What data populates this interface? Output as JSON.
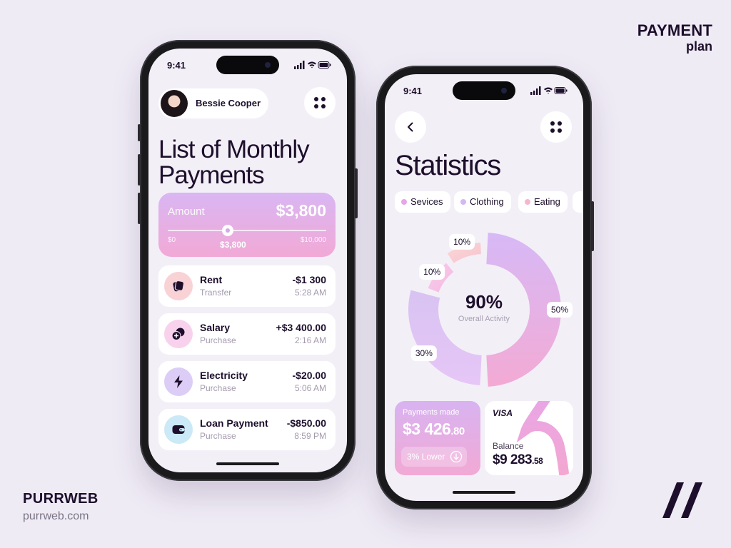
{
  "brand": {
    "top_right_line1": "PAYMENT",
    "top_right_line2": "plan",
    "bottom_left_name": "PURRWEB",
    "bottom_left_url": "purrweb.com"
  },
  "phone1": {
    "status_time": "9:41",
    "user_name": "Bessie Cooper",
    "title_line1": "List of Monthly",
    "title_line2": "Payments",
    "amount": {
      "label": "Amount",
      "value": "$3,800",
      "min": "$0",
      "current": "$3,800",
      "max": "$10,000",
      "slider_fraction": 0.38
    },
    "payments": [
      {
        "name": "Rent",
        "type": "Transfer",
        "amount": "-$1 300",
        "time": "5:28 AM",
        "icon": "cards-icon",
        "icon_bg": "#f9d2d6"
      },
      {
        "name": "Salary",
        "type": "Purchase",
        "amount": "+$3 400.00",
        "time": "2:16 AM",
        "icon": "coins-plus-icon",
        "icon_bg": "#f8d2ec"
      },
      {
        "name": "Electricity",
        "type": "Purchase",
        "amount": "-$20.00",
        "time": "5:06 AM",
        "icon": "lightning-icon",
        "icon_bg": "#dccdf7"
      },
      {
        "name": "Loan Payment",
        "type": "Purchase",
        "amount": "-$850.00",
        "time": "8:59 PM",
        "icon": "wallet-icon",
        "icon_bg": "#cbe9f6"
      }
    ]
  },
  "phone2": {
    "status_time": "9:41",
    "title": "Statistics",
    "chips": [
      {
        "label": "Sevices",
        "color": "#e7a6e6"
      },
      {
        "label": "Clothing",
        "color": "#d5b8f3"
      },
      {
        "label": "Eating",
        "color": "#f6b6cf"
      }
    ],
    "chart": {
      "center_value": "90%",
      "center_label": "Overall Activity",
      "segments": [
        {
          "label": "50%",
          "value": 50,
          "color": "#dcb5f0"
        },
        {
          "label": "30%",
          "value": 30,
          "color": "#dcc4f6"
        },
        {
          "label": "10%",
          "value": 10,
          "color": "#f6c2e4"
        },
        {
          "label": "10%",
          "value": 10,
          "color": "#f9cfd4"
        }
      ]
    },
    "payments_made": {
      "label": "Payments made",
      "value_main": "$3 426",
      "value_cents": ".80",
      "trend": "3% Lower"
    },
    "card": {
      "brand": "VISA",
      "balance_label": "Balance",
      "balance_main": "$9 283",
      "balance_cents": ".58"
    }
  }
}
